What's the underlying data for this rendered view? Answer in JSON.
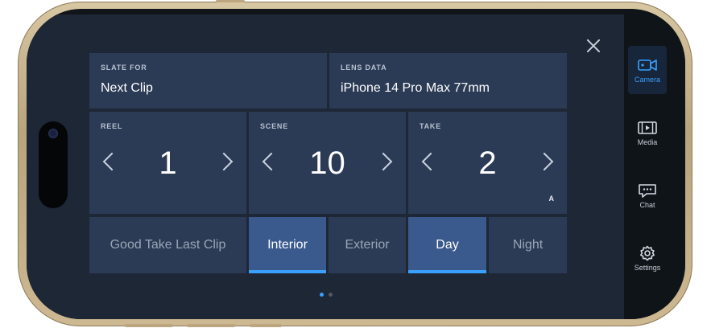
{
  "close": {
    "icon": "close-icon"
  },
  "slate": {
    "label": "SLATE FOR",
    "value": "Next Clip"
  },
  "lens": {
    "label": "LENS DATA",
    "value": "iPhone 14 Pro Max 77mm"
  },
  "reel": {
    "label": "REEL",
    "value": "1"
  },
  "scene": {
    "label": "SCENE",
    "value": "10"
  },
  "take": {
    "label": "TAKE",
    "value": "2",
    "sub": "A"
  },
  "toggles": {
    "good_take": {
      "label": "Good Take Last Clip",
      "active": false
    },
    "interior": {
      "label": "Interior",
      "active": true
    },
    "exterior": {
      "label": "Exterior",
      "active": false
    },
    "day": {
      "label": "Day",
      "active": true
    },
    "night": {
      "label": "Night",
      "active": false
    }
  },
  "pager": {
    "current": 1,
    "total": 2
  },
  "rail": {
    "items": [
      {
        "label": "Camera",
        "icon": "video-camera-icon",
        "active": true
      },
      {
        "label": "Media",
        "icon": "film-strip-icon",
        "active": false
      },
      {
        "label": "Chat",
        "icon": "chat-bubble-icon",
        "active": false
      },
      {
        "label": "Settings",
        "icon": "gear-icon",
        "active": false
      }
    ]
  },
  "colors": {
    "accent": "#3aa0ff",
    "card": "#2b3a55",
    "toggle_active": "#3a5a8e",
    "background": "#1d2735"
  }
}
